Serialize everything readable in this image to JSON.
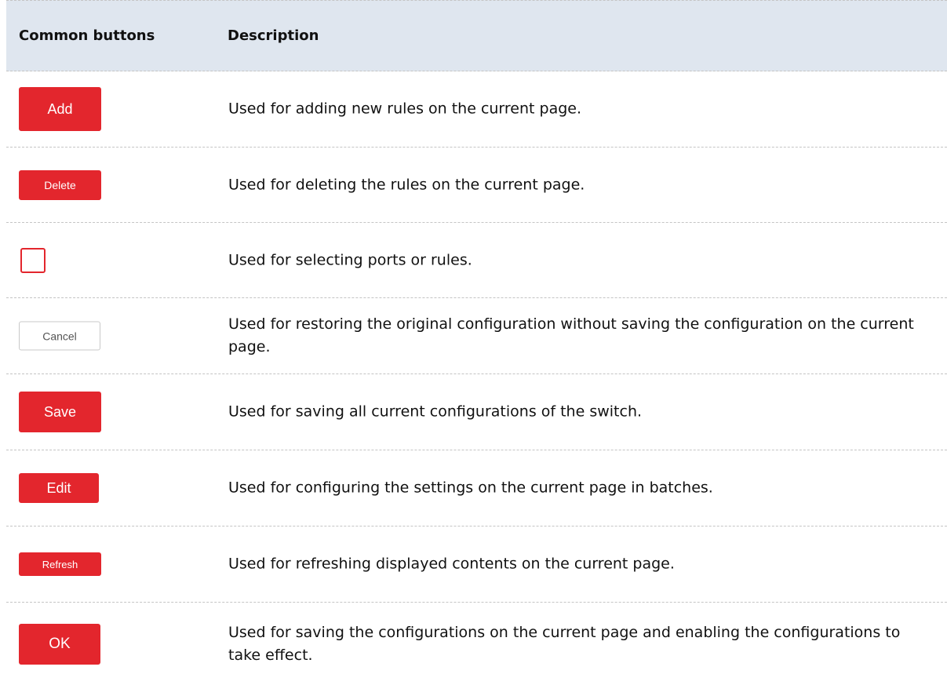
{
  "header": {
    "col1": "Common buttons",
    "col2": "Description"
  },
  "rows": [
    {
      "button": "Add",
      "description": "Used for adding new rules on the current page."
    },
    {
      "button": "Delete",
      "description": "Used for deleting the rules on the current page."
    },
    {
      "button": "",
      "description": "Used for selecting ports or rules."
    },
    {
      "button": "Cancel",
      "description": "Used for restoring the original configuration without saving the configuration on the current page."
    },
    {
      "button": "Save",
      "description": "Used for saving all current configurations of the switch."
    },
    {
      "button": "Edit",
      "description": "Used for configuring the settings on the current page in batches."
    },
    {
      "button": "Refresh",
      "description": "Used for refreshing displayed contents on the current page."
    },
    {
      "button": "OK",
      "description": "Used for saving the configurations on the current page and enabling the configurations to take effect."
    }
  ],
  "colors": {
    "accent": "#e3262d",
    "header_bg": "#dfe6ef"
  }
}
